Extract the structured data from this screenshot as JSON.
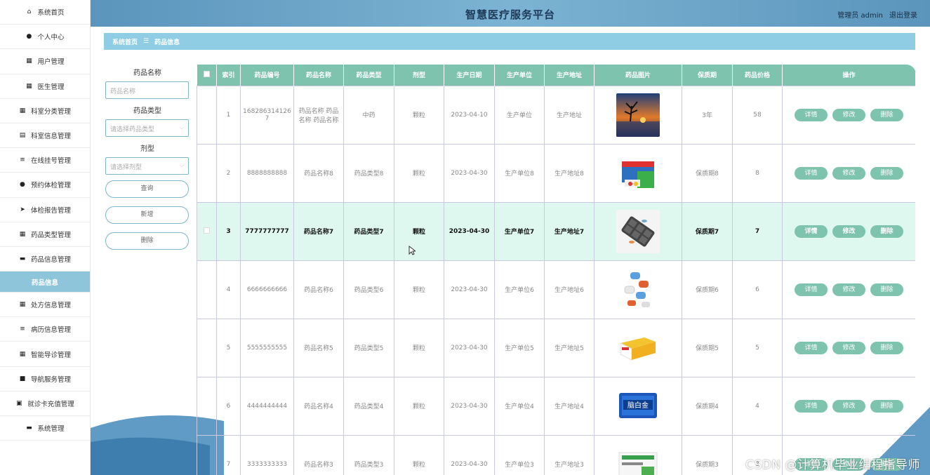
{
  "header": {
    "title": "智慧医疗服务平台",
    "user_label": "管理员 admin",
    "logout": "退出登录"
  },
  "breadcrumb": {
    "home": "系统首页",
    "sep": "☰",
    "current": "药品信息"
  },
  "sidebar": {
    "items": [
      {
        "label": "系统首页",
        "icon": "home-icon",
        "glyph": "⌂"
      },
      {
        "label": "个人中心",
        "icon": "person-icon",
        "glyph": "●"
      },
      {
        "label": "用户管理",
        "icon": "grid-icon",
        "glyph": "▦"
      },
      {
        "label": "医生管理",
        "icon": "grid-icon",
        "glyph": "▦"
      },
      {
        "label": "科室分类管理",
        "icon": "grid-icon",
        "glyph": "▦"
      },
      {
        "label": "科室信息管理",
        "icon": "clipboard-icon",
        "glyph": "▤"
      },
      {
        "label": "在线挂号管理",
        "icon": "list-icon",
        "glyph": "≡"
      },
      {
        "label": "预约体检管理",
        "icon": "user-icon",
        "glyph": "●"
      },
      {
        "label": "体检报告管理",
        "icon": "send-icon",
        "glyph": "➤"
      },
      {
        "label": "药品类型管理",
        "icon": "grid-icon",
        "glyph": "▦"
      },
      {
        "label": "药品信息管理",
        "icon": "monitor-icon",
        "glyph": "▬"
      },
      {
        "label": "药品信息",
        "icon": "",
        "glyph": "",
        "sub": true
      },
      {
        "label": "处方信息管理",
        "icon": "grid-icon",
        "glyph": "▦"
      },
      {
        "label": "病历信息管理",
        "icon": "list-icon",
        "glyph": "≡"
      },
      {
        "label": "智能导诊管理",
        "icon": "grid-icon",
        "glyph": "▦"
      },
      {
        "label": "导航服务管理",
        "icon": "video-icon",
        "glyph": "■"
      },
      {
        "label": "就诊卡充值管理",
        "icon": "briefcase-icon",
        "glyph": "▣"
      },
      {
        "label": "系统管理",
        "icon": "monitor-icon",
        "glyph": "▬"
      }
    ]
  },
  "filters": {
    "name_label": "药品名称",
    "name_placeholder": "药品名称",
    "type_label": "药品类型",
    "type_placeholder": "请选择药品类型",
    "form_label": "剂型",
    "form_placeholder": "请选择剂型",
    "search_button": "查询",
    "add_button": "新增",
    "delete_button": "删除"
  },
  "table": {
    "columns": [
      "索引",
      "药品编号",
      "药品名称",
      "药品类型",
      "剂型",
      "生产日期",
      "生产单位",
      "生产地址",
      "药品图片",
      "保质期",
      "药品价格",
      "操作"
    ],
    "actions": {
      "detail": "详情",
      "edit": "修改",
      "delete": "删除"
    },
    "rows": [
      {
        "idx": "1",
        "code": "1682863141267",
        "name": "药品名称 药品名称 药品名称",
        "type": "中药",
        "form": "颗粒",
        "date": "2023-04-10",
        "maker": "生产单位",
        "addr": "生产地址",
        "shelf": "3年",
        "price": "58",
        "img": "sunset"
      },
      {
        "idx": "2",
        "code": "8888888888",
        "name": "药品名称8",
        "type": "药品类型8",
        "form": "颗粒",
        "date": "2023-04-30",
        "maker": "生产单位8",
        "addr": "生产地址8",
        "shelf": "保质期8",
        "price": "8",
        "img": "box-green"
      },
      {
        "idx": "3",
        "code": "7777777777",
        "name": "药品名称7",
        "type": "药品类型7",
        "form": "颗粒",
        "date": "2023-04-30",
        "maker": "生产单位7",
        "addr": "生产地址7",
        "shelf": "保质期7",
        "price": "7",
        "img": "pillbox",
        "highlight": true
      },
      {
        "idx": "4",
        "code": "6666666666",
        "name": "药品名称6",
        "type": "药品类型6",
        "form": "颗粒",
        "date": "2023-04-30",
        "maker": "生产单位6",
        "addr": "生产地址6",
        "shelf": "保质期6",
        "price": "6",
        "img": "pills"
      },
      {
        "idx": "5",
        "code": "5555555555",
        "name": "药品名称5",
        "type": "药品类型5",
        "form": "颗粒",
        "date": "2023-04-30",
        "maker": "生产单位5",
        "addr": "生产地址5",
        "shelf": "保质期5",
        "price": "5",
        "img": "box-yellow"
      },
      {
        "idx": "6",
        "code": "4444444444",
        "name": "药品名称4",
        "type": "药品类型4",
        "form": "颗粒",
        "date": "2023-04-30",
        "maker": "生产单位4",
        "addr": "生产地址4",
        "shelf": "保质期4",
        "price": "4",
        "img": "box-blue"
      },
      {
        "idx": "7",
        "code": "3333333333",
        "name": "药品名称3",
        "type": "药品类型3",
        "form": "颗粒",
        "date": "2023-04-30",
        "maker": "生产单位3",
        "addr": "生产地址3",
        "shelf": "保质期3",
        "price": "3",
        "img": "box-white"
      }
    ]
  },
  "watermark": "CSDN @计算机毕业编程指导师"
}
